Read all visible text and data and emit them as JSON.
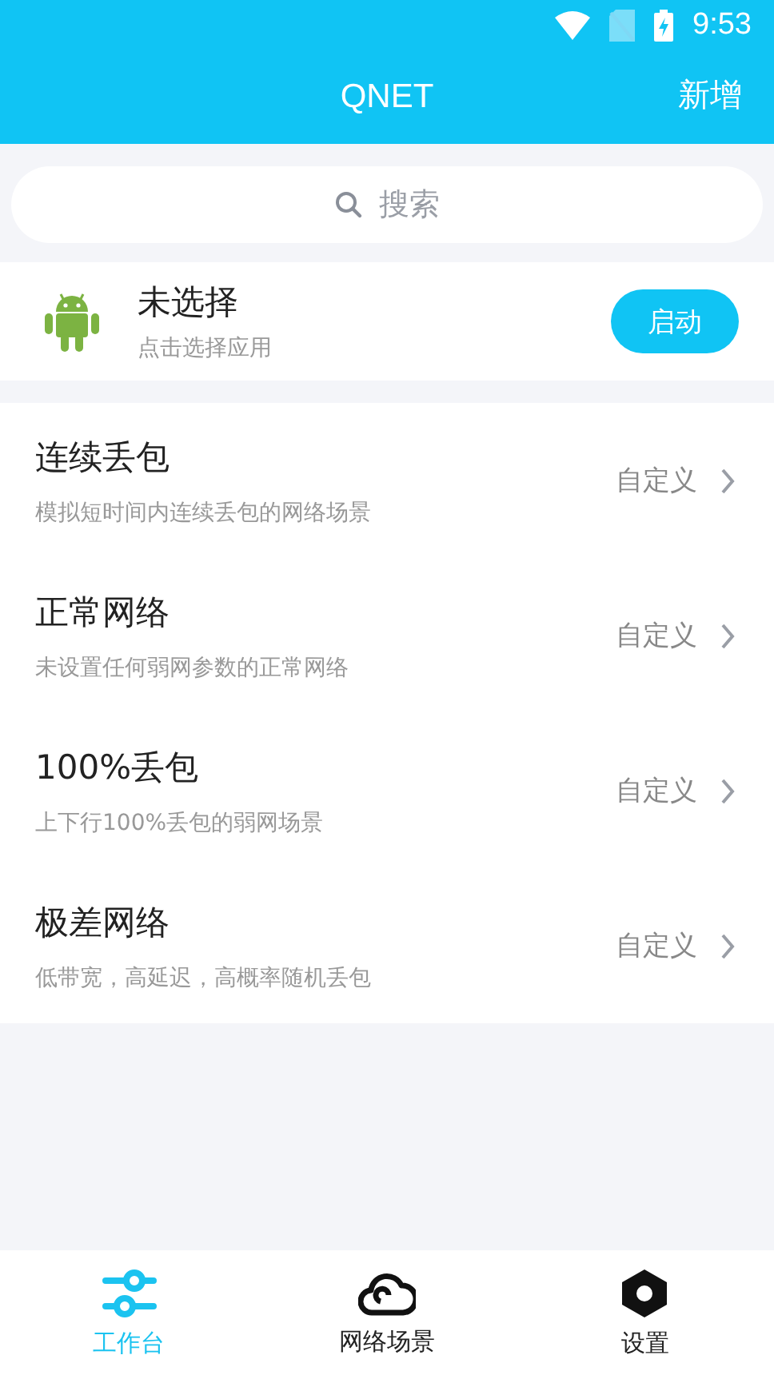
{
  "status_bar": {
    "time": "9:53"
  },
  "header": {
    "title": "QNET",
    "action": "新增"
  },
  "search": {
    "placeholder": "搜索"
  },
  "app": {
    "name": "未选择",
    "hint": "点击选择应用",
    "button": "启动"
  },
  "scenes": [
    {
      "title": "连续丢包",
      "desc": "模拟短时间内连续丢包的网络场景",
      "action": "自定义"
    },
    {
      "title": "正常网络",
      "desc": "未设置任何弱网参数的正常网络",
      "action": "自定义"
    },
    {
      "title": "100%丢包",
      "desc": "上下行100%丢包的弱网场景",
      "action": "自定义"
    },
    {
      "title": "极差网络",
      "desc": "低带宽，高延迟，高概率随机丢包",
      "action": "自定义"
    }
  ],
  "tabs": [
    {
      "kind": "sliders",
      "label": "工作台",
      "selected": true
    },
    {
      "kind": "cloud",
      "label": "网络场景",
      "selected": false
    },
    {
      "kind": "settings",
      "label": "设置",
      "selected": false
    }
  ]
}
